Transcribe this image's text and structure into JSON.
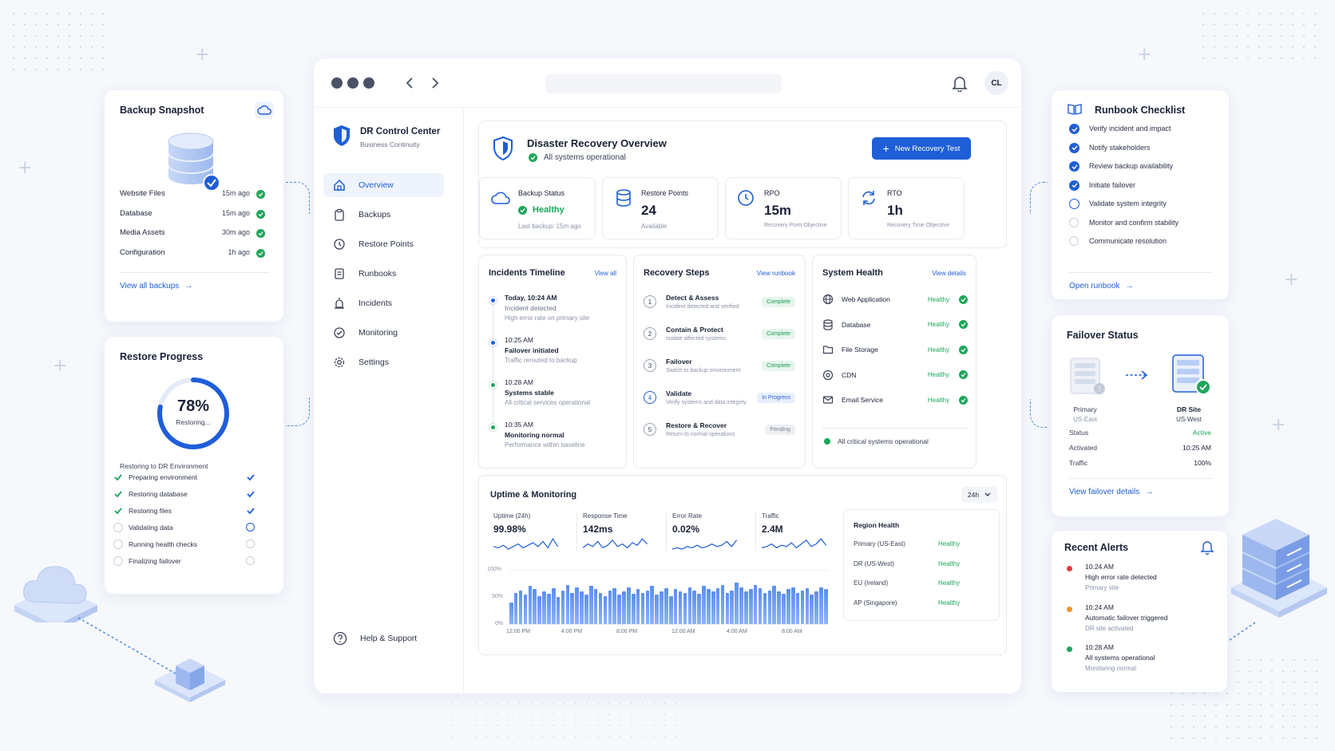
{
  "window": {
    "avatar": "CL"
  },
  "brand": {
    "title": "DR Control Center",
    "subtitle": "Business Continuity"
  },
  "nav": {
    "items": [
      {
        "label": "Overview"
      },
      {
        "label": "Backups"
      },
      {
        "label": "Restore Points"
      },
      {
        "label": "Runbooks"
      },
      {
        "label": "Incidents"
      },
      {
        "label": "Monitoring"
      },
      {
        "label": "Settings"
      }
    ],
    "help": "Help & Support"
  },
  "overview": {
    "title": "Disaster Recovery Overview",
    "status": "All systems operational",
    "new_test": "New Recovery Test"
  },
  "stats": [
    {
      "label": "Backup Status",
      "value": "Healthy",
      "sub": "Last backup: 15m ago",
      "icon": "cloud-icon"
    },
    {
      "label": "Restore Points",
      "value": "24",
      "sub": "Available",
      "icon": "database-icon"
    },
    {
      "label": "RPO",
      "value": "15m",
      "sub": "Recovery Point Objective",
      "icon": "clock-icon"
    },
    {
      "label": "RTO",
      "value": "1h",
      "sub": "Recovery Time Objective",
      "icon": "refresh-icon"
    }
  ],
  "incidents": {
    "title": "Incidents Timeline",
    "link": "View all",
    "items": [
      {
        "time": "Today, 10:24 AM",
        "title": "Incident detected",
        "desc": "High error rate on primary site",
        "color": "#1f5ed8"
      },
      {
        "time": "10:25 AM",
        "title": "Failover initiated",
        "desc": "Traffic rerouted to backup",
        "color": "#1f5ed8"
      },
      {
        "time": "10:28 AM",
        "title": "Systems stable",
        "desc": "All critical services operational",
        "color": "#1ea65a"
      },
      {
        "time": "10:35 AM",
        "title": "Monitoring normal",
        "desc": "Performance within baseline",
        "color": "#1ea65a"
      }
    ]
  },
  "steps": {
    "title": "Recovery Steps",
    "link": "View runbook",
    "items": [
      {
        "num": "1",
        "title": "Detect & Assess",
        "desc": "Incident detected and verified",
        "status": "Complete",
        "kind": "c"
      },
      {
        "num": "2",
        "title": "Contain & Protect",
        "desc": "Isolate affected systems",
        "status": "Complete",
        "kind": "c"
      },
      {
        "num": "3",
        "title": "Failover",
        "desc": "Switch to backup environment",
        "status": "Complete",
        "kind": "c"
      },
      {
        "num": "4",
        "title": "Validate",
        "desc": "Verify systems and data integrity",
        "status": "In Progress",
        "kind": "p"
      },
      {
        "num": "5",
        "title": "Restore & Recover",
        "desc": "Return to normal operations",
        "status": "Pending",
        "kind": "n"
      }
    ]
  },
  "health": {
    "title": "System Health",
    "link": "View details",
    "footer": "All critical systems operational",
    "items": [
      {
        "name": "Web Application",
        "status": "Healthy"
      },
      {
        "name": "Database",
        "status": "Healthy"
      },
      {
        "name": "File Storage",
        "status": "Healthy"
      },
      {
        "name": "CDN",
        "status": "Healthy"
      },
      {
        "name": "Email Service",
        "status": "Healthy"
      }
    ]
  },
  "uptime": {
    "title": "Uptime & Monitoring",
    "range": "24h",
    "metrics": [
      {
        "label": "Uptime (24h)",
        "value": "99.98%"
      },
      {
        "label": "Response Time",
        "value": "142ms"
      },
      {
        "label": "Error Rate",
        "value": "0.02%"
      },
      {
        "label": "Traffic",
        "value": "2.4M"
      }
    ]
  },
  "chart_data": {
    "type": "bar",
    "y_ticks": [
      "100%",
      "50%",
      "0%"
    ],
    "x_ticks": [
      "12:00 PM",
      "4:00 PM",
      "8:00 PM",
      "12:00 AM",
      "4:00 AM",
      "8:00 AM"
    ],
    "ylim": [
      0,
      100
    ],
    "values": [
      40,
      58,
      62,
      55,
      70,
      64,
      52,
      60,
      56,
      66,
      50,
      62,
      72,
      58,
      68,
      60,
      55,
      70,
      64,
      58,
      52,
      62,
      66,
      54,
      60,
      68,
      56,
      64,
      58,
      62,
      70,
      55,
      60,
      66,
      52,
      64,
      60,
      58,
      68,
      62,
      56,
      70,
      64,
      60,
      66,
      72,
      58,
      62,
      76,
      68,
      60,
      64,
      72,
      66,
      58,
      62,
      70,
      60,
      56,
      64,
      68,
      58,
      62,
      66,
      54,
      60,
      68,
      64
    ]
  },
  "regions": {
    "title": "Region Health",
    "items": [
      {
        "name": "Primary (US-East)",
        "status": "Healthy"
      },
      {
        "name": "DR (US-West)",
        "status": "Healthy"
      },
      {
        "name": "EU (Ireland)",
        "status": "Healthy"
      },
      {
        "name": "AP (Singapore)",
        "status": "Healthy"
      }
    ]
  },
  "backup": {
    "title": "Backup Snapshot",
    "link": "View all backups",
    "items": [
      {
        "name": "Website Files",
        "ago": "15m ago"
      },
      {
        "name": "Database",
        "ago": "15m ago"
      },
      {
        "name": "Media Assets",
        "ago": "30m ago"
      },
      {
        "name": "Configuration",
        "ago": "1h ago"
      }
    ]
  },
  "restore": {
    "title": "Restore Progress",
    "percent": "78%",
    "progress": 0.78,
    "state": "Restoring...",
    "target": "Restoring to DR Environment",
    "items": [
      {
        "label": "Preparing environment",
        "state": "done"
      },
      {
        "label": "Restoring database",
        "state": "done"
      },
      {
        "label": "Restoring files",
        "state": "done"
      },
      {
        "label": "Validating data",
        "state": "active"
      },
      {
        "label": "Running health checks",
        "state": "pending"
      },
      {
        "label": "Finalizing failover",
        "state": "pending"
      }
    ]
  },
  "runbook": {
    "title": "Runbook Checklist",
    "link": "Open runbook",
    "items": [
      {
        "label": "Verify incident and impact",
        "state": "done"
      },
      {
        "label": "Notify stakeholders",
        "state": "done"
      },
      {
        "label": "Review backup availability",
        "state": "done"
      },
      {
        "label": "Initiate failover",
        "state": "done"
      },
      {
        "label": "Validate system integrity",
        "state": "active"
      },
      {
        "label": "Monitor and confirm stability",
        "state": "pending"
      },
      {
        "label": "Communicate resolution",
        "state": "pending"
      }
    ]
  },
  "failover": {
    "title": "Failover Status",
    "primary": "Primary",
    "primary_region": "US-East",
    "dr": "DR Site",
    "dr_region": "US-West",
    "link": "View failover details",
    "rows": [
      {
        "key": "Status",
        "value": "Active"
      },
      {
        "key": "Activated",
        "value": "10:25 AM"
      },
      {
        "key": "Traffic",
        "value": "100%"
      }
    ]
  },
  "alerts": {
    "title": "Recent Alerts",
    "items": [
      {
        "time": "10:24 AM",
        "title": "High error rate detected",
        "desc": "Primary site",
        "color": "#e03a3a"
      },
      {
        "time": "10:24 AM",
        "title": "Automatic failover triggered",
        "desc": "DR site activated",
        "color": "#f0932b"
      },
      {
        "time": "10:28 AM",
        "title": "All systems operational",
        "desc": "Monitoring normal",
        "color": "#1ea65a"
      }
    ]
  }
}
